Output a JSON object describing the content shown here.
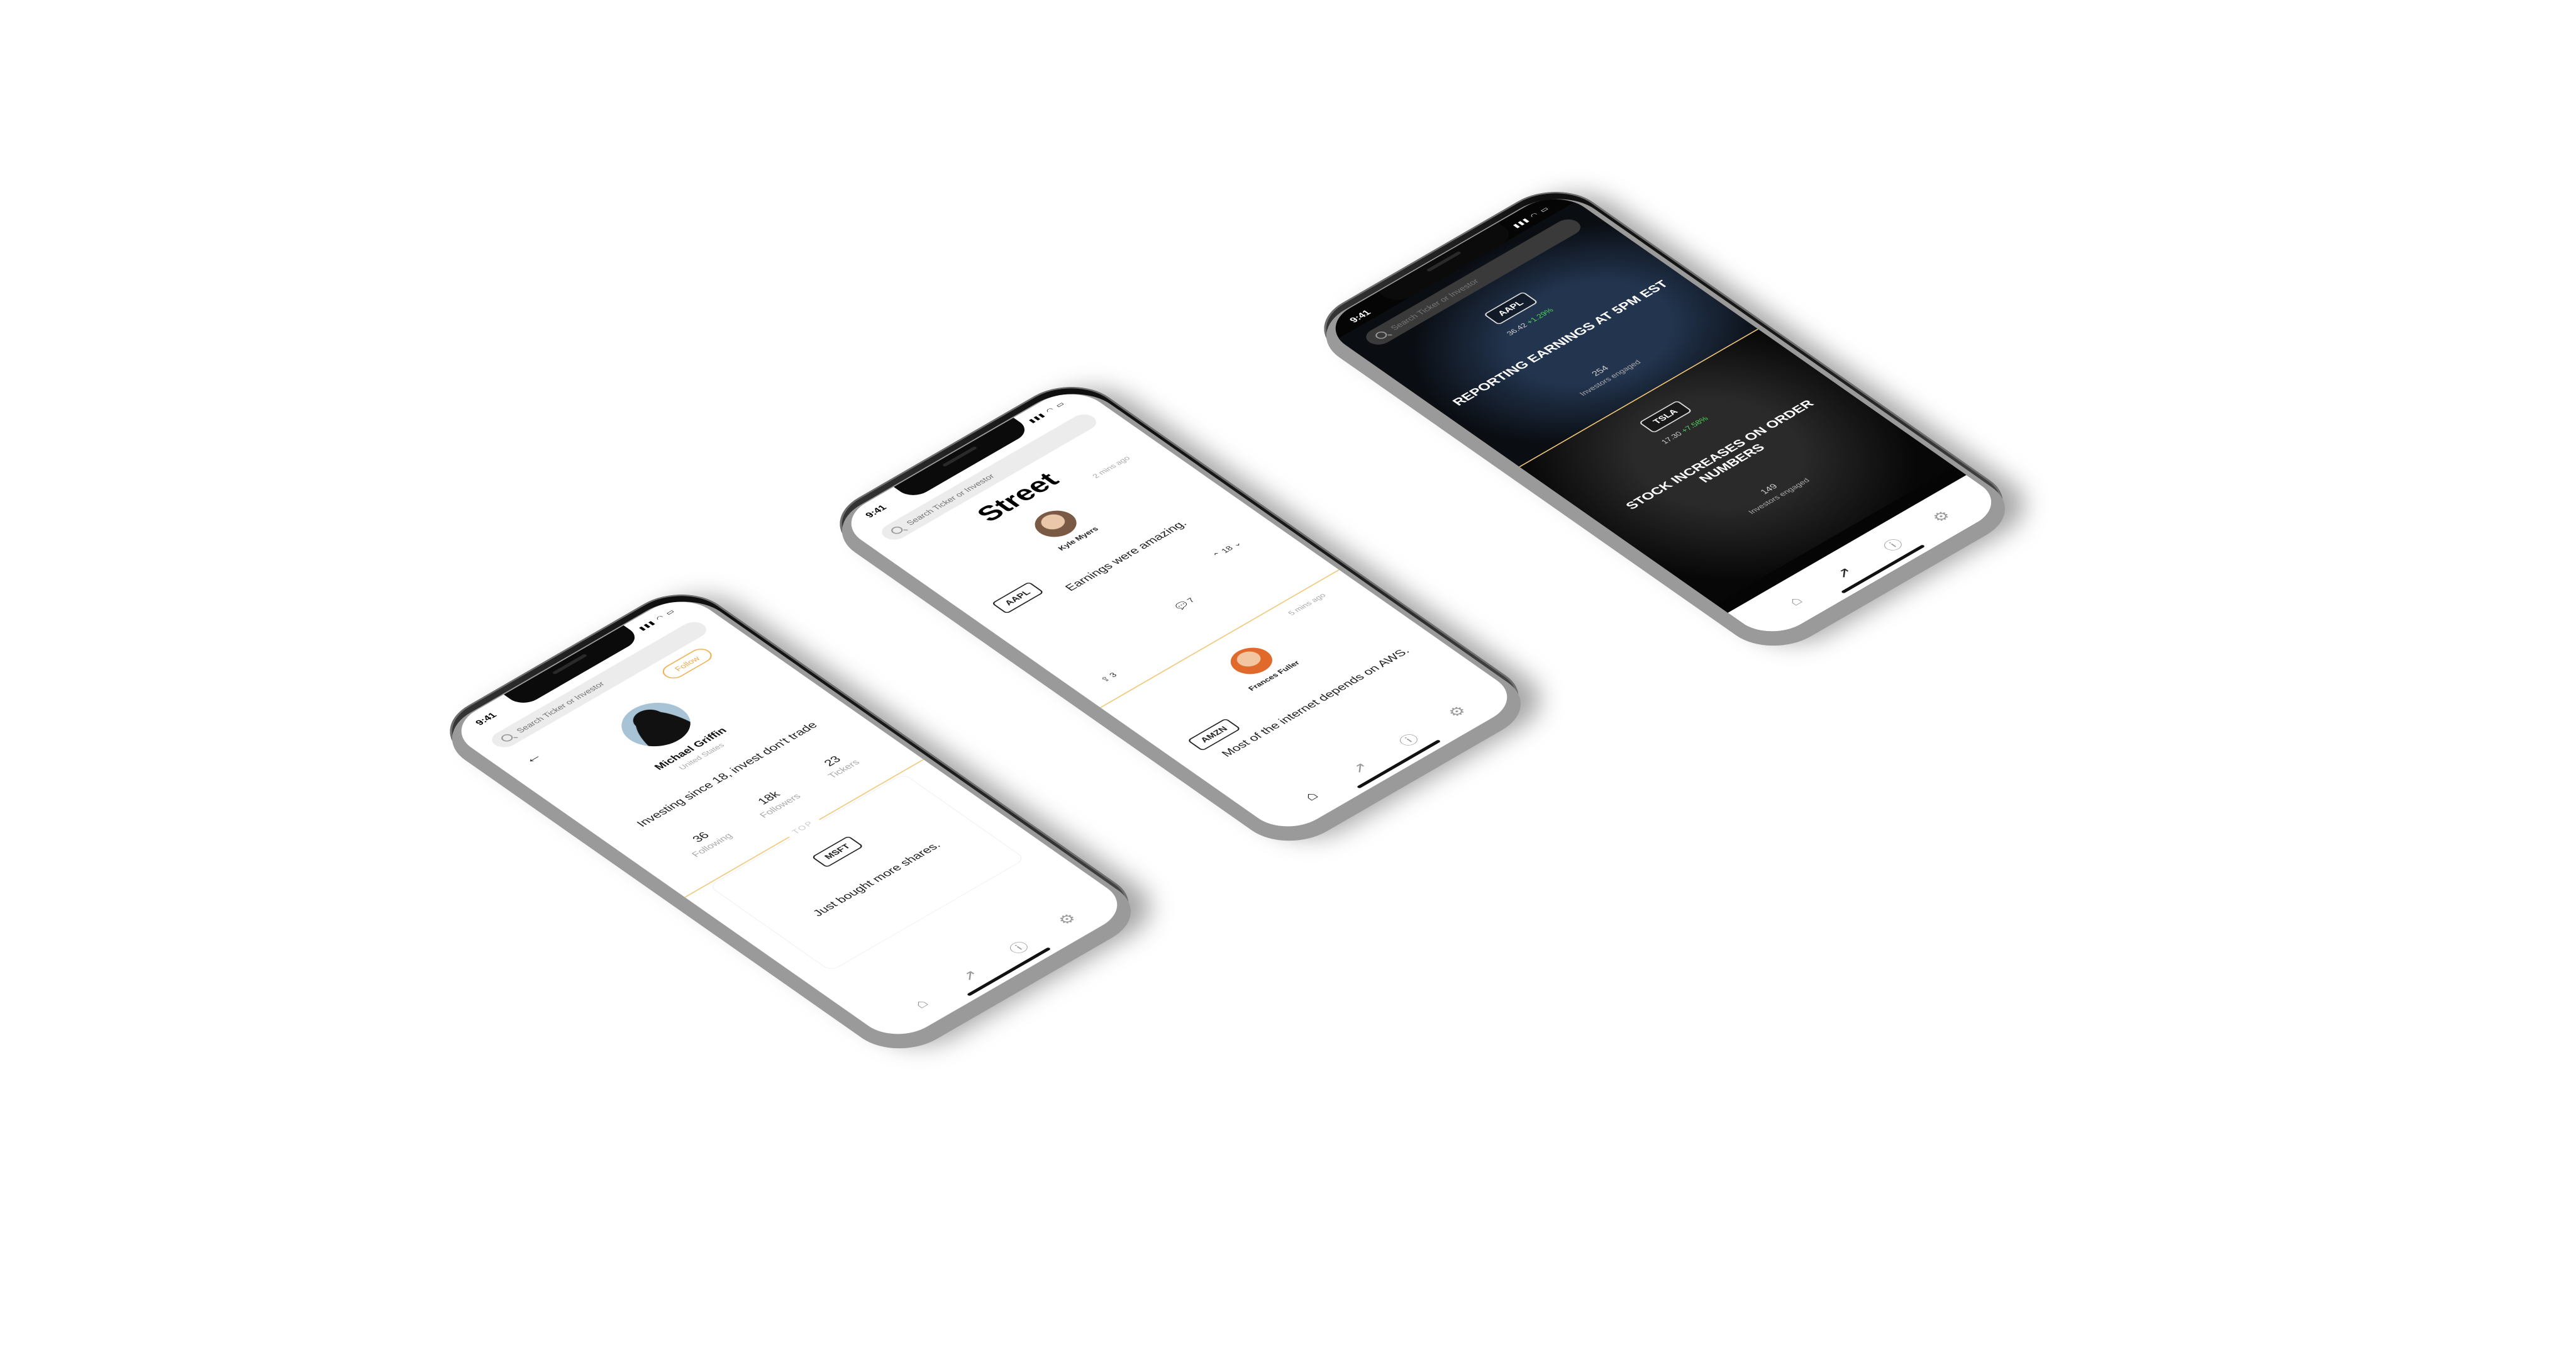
{
  "status_time": "9:41",
  "status_icons": "▮▮▮ ◠ ▭",
  "search_placeholder": "Search Ticker or Investor",
  "profile": {
    "follow_label": "Follow",
    "name": "Michael Griffin",
    "location": "United States",
    "bio": "Investing since 18, invest don't trade",
    "stats": [
      {
        "value": "36",
        "label": "Following"
      },
      {
        "value": "18k",
        "label": "Followers"
      },
      {
        "value": "23",
        "label": "Tickers"
      }
    ],
    "top_label": "TOP",
    "top_post": {
      "ticker": "MSFT",
      "text": "Just bought more shares."
    }
  },
  "feed": {
    "title": "Street",
    "posts": [
      {
        "time": "2 mins ago",
        "author": "Kyle Myers",
        "ticker": "AAPL",
        "text": "Earnings were amazing.",
        "votes": "18",
        "comments": "7",
        "shares": "3"
      },
      {
        "time": "5 mins ago",
        "author": "Frances Fuller",
        "ticker": "AMZN",
        "text": "Most of the internet depends on AWS."
      }
    ]
  },
  "trending": {
    "items": [
      {
        "ticker": "AAPL",
        "price": "36.42",
        "change": "+1.29%",
        "headline": "REPORTING EARNINGS AT 5PM EST",
        "count": "254",
        "sub": "Investors engaged"
      },
      {
        "ticker": "TSLA",
        "price": "17.30",
        "change": "+7.58%",
        "headline": "STOCK INCREASES ON ORDER NUMBERS",
        "count": "149",
        "sub": "Investors engaged"
      }
    ]
  },
  "colors": {
    "accent_gold": "#f1c878",
    "follow_orange": "#f0a94a",
    "positive_green": "#4fd35a"
  },
  "tab_icons": [
    "home-icon",
    "trending-icon",
    "info-icon",
    "gear-icon"
  ]
}
